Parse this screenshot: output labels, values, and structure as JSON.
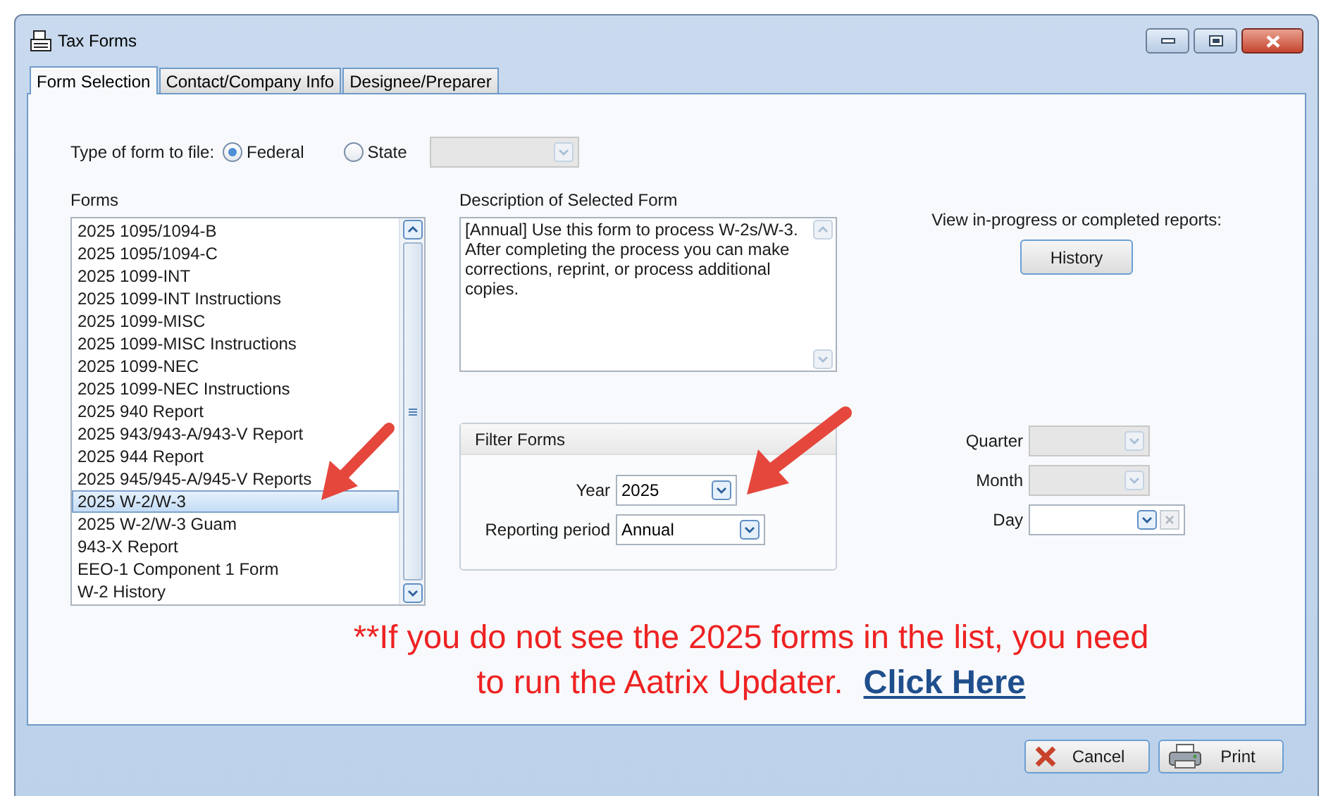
{
  "window": {
    "title": "Tax Forms"
  },
  "tabs": [
    {
      "label": "Form Selection",
      "selected": true
    },
    {
      "label": "Contact/Company Info",
      "selected": false
    },
    {
      "label": "Designee/Preparer",
      "selected": false
    }
  ],
  "form_type": {
    "label": "Type of form to file:",
    "options": [
      {
        "label": "Federal",
        "selected": true
      },
      {
        "label": "State",
        "selected": false
      }
    ],
    "state_dropdown": {
      "disabled": true
    }
  },
  "forms": {
    "label": "Forms",
    "items": [
      {
        "label": "2025 1095/1094-B",
        "selected": false
      },
      {
        "label": "2025 1095/1094-C",
        "selected": false
      },
      {
        "label": "2025 1099-INT",
        "selected": false
      },
      {
        "label": "2025 1099-INT Instructions",
        "selected": false
      },
      {
        "label": "2025 1099-MISC",
        "selected": false
      },
      {
        "label": "2025 1099-MISC Instructions",
        "selected": false
      },
      {
        "label": "2025 1099-NEC",
        "selected": false
      },
      {
        "label": "2025 1099-NEC Instructions",
        "selected": false
      },
      {
        "label": "2025 940 Report",
        "selected": false
      },
      {
        "label": "2025 943/943-A/943-V Report",
        "selected": false
      },
      {
        "label": "2025 944 Report",
        "selected": false
      },
      {
        "label": "2025 945/945-A/945-V Reports",
        "selected": false
      },
      {
        "label": "2025 W-2/W-3",
        "selected": true
      },
      {
        "label": "2025 W-2/W-3 Guam",
        "selected": false
      },
      {
        "label": "943-X Report",
        "selected": false
      },
      {
        "label": "EEO-1 Component 1 Form",
        "selected": false
      },
      {
        "label": "W-2 History",
        "selected": false
      }
    ]
  },
  "description": {
    "label": "Description of Selected Form",
    "text": "[Annual] Use this form to process W-2s/W-3. After completing the process you can make corrections, reprint, or process additional copies."
  },
  "filter": {
    "title": "Filter Forms",
    "fields": [
      {
        "label": "Year",
        "value": "2025"
      },
      {
        "label": "Reporting period",
        "value": "Annual"
      }
    ]
  },
  "history": {
    "prompt": "View in-progress or completed reports:",
    "button": "History"
  },
  "period": [
    {
      "label": "Quarter",
      "kind": "combo",
      "disabled": true
    },
    {
      "label": "Month",
      "kind": "combo",
      "disabled": true
    },
    {
      "label": "Day",
      "kind": "date",
      "disabled": false
    }
  ],
  "notice": {
    "text": "**If you do not see the 2025 forms in the list, you need to run the Aatrix Updater.",
    "link": "Click Here"
  },
  "buttons": [
    {
      "label": "Cancel",
      "kind": "cancel"
    },
    {
      "label": "Print",
      "kind": "print"
    }
  ]
}
